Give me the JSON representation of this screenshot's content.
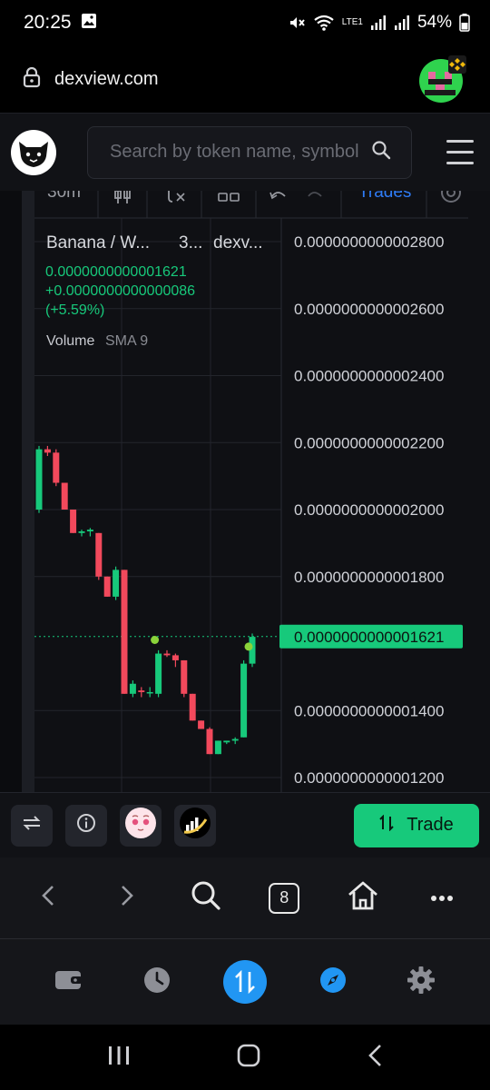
{
  "status_bar": {
    "time": "20:25",
    "network_label": "LTE1",
    "battery": "54%"
  },
  "url_bar": {
    "domain": "dexview.com"
  },
  "header": {
    "search_placeholder": "Search by token name, symbol"
  },
  "chart_toolbar": {
    "timeframe": "30m",
    "trades_label": "Trades"
  },
  "legend": {
    "pair_title": "Banana / W...",
    "interval": "3...",
    "source": "dexv...",
    "last_price": "0.0000000000001621",
    "change_abs": "+0.0000000000000086",
    "change_pct": "(+5.59%)",
    "volume_label": "Volume",
    "volume_indicator": "SMA 9"
  },
  "chart_data": {
    "type": "candlestick",
    "y_axis_ticks": [
      "0.0000000000002800",
      "0.0000000000002600",
      "0.0000000000002400",
      "0.0000000000002200",
      "0.0000000000002000",
      "0.0000000000001800",
      "0.0000000000001400",
      "0.0000000000001200"
    ],
    "ylim": [
      1.2e-13,
      2.8e-13
    ],
    "current_price_label": "0.0000000000001621",
    "current_price": 1.621e-13,
    "candles": [
      {
        "o": 2e-13,
        "h": 2.19e-13,
        "l": 1.99e-13,
        "c": 2.18e-13
      },
      {
        "o": 2.18e-13,
        "h": 2.19e-13,
        "l": 2.16e-13,
        "c": 2.17e-13
      },
      {
        "o": 2.17e-13,
        "h": 2.18e-13,
        "l": 2.07e-13,
        "c": 2.08e-13
      },
      {
        "o": 2.08e-13,
        "h": 2.08e-13,
        "l": 2e-13,
        "c": 2e-13
      },
      {
        "o": 2e-13,
        "h": 2e-13,
        "l": 1.93e-13,
        "c": 1.93e-13
      },
      {
        "o": 1.93e-13,
        "h": 1.94e-13,
        "l": 1.92e-13,
        "c": 1.935e-13
      },
      {
        "o": 1.935e-13,
        "h": 1.945e-13,
        "l": 1.92e-13,
        "c": 1.94e-13
      },
      {
        "o": 1.93e-13,
        "h": 1.93e-13,
        "l": 1.79e-13,
        "c": 1.8e-13
      },
      {
        "o": 1.8e-13,
        "h": 1.8e-13,
        "l": 1.74e-13,
        "c": 1.74e-13
      },
      {
        "o": 1.74e-13,
        "h": 1.83e-13,
        "l": 1.73e-13,
        "c": 1.82e-13
      },
      {
        "o": 1.82e-13,
        "h": 1.82e-13,
        "l": 1.45e-13,
        "c": 1.45e-13
      },
      {
        "o": 1.45e-13,
        "h": 1.49e-13,
        "l": 1.44e-13,
        "c": 1.48e-13
      },
      {
        "o": 1.46e-13,
        "h": 1.47e-13,
        "l": 1.44e-13,
        "c": 1.455e-13
      },
      {
        "o": 1.455e-13,
        "h": 1.47e-13,
        "l": 1.44e-13,
        "c": 1.455e-13
      },
      {
        "o": 1.45e-13,
        "h": 1.58e-13,
        "l": 1.44e-13,
        "c": 1.57e-13
      },
      {
        "o": 1.57e-13,
        "h": 1.58e-13,
        "l": 1.56e-13,
        "c": 1.565e-13
      },
      {
        "o": 1.565e-13,
        "h": 1.57e-13,
        "l": 1.53e-13,
        "c": 1.55e-13
      },
      {
        "o": 1.55e-13,
        "h": 1.55e-13,
        "l": 1.44e-13,
        "c": 1.45e-13
      },
      {
        "o": 1.45e-13,
        "h": 1.45e-13,
        "l": 1.37e-13,
        "c": 1.37e-13
      },
      {
        "o": 1.37e-13,
        "h": 1.37e-13,
        "l": 1.345e-13,
        "c": 1.345e-13
      },
      {
        "o": 1.345e-13,
        "h": 1.35e-13,
        "l": 1.27e-13,
        "c": 1.27e-13
      },
      {
        "o": 1.27e-13,
        "h": 1.31e-13,
        "l": 1.27e-13,
        "c": 1.31e-13
      },
      {
        "o": 1.305e-13,
        "h": 1.31e-13,
        "l": 1.3e-13,
        "c": 1.31e-13
      },
      {
        "o": 1.31e-13,
        "h": 1.32e-13,
        "l": 1.3e-13,
        "c": 1.315e-13
      },
      {
        "o": 1.32e-13,
        "h": 1.55e-13,
        "l": 1.32e-13,
        "c": 1.54e-13
      },
      {
        "o": 1.54e-13,
        "h": 1.63e-13,
        "l": 1.53e-13,
        "c": 1.62e-13
      }
    ],
    "markers": [
      {
        "index": 14,
        "price": 1.6e-13
      },
      {
        "index": 25,
        "price": 1.58e-13
      }
    ],
    "colors": {
      "up": "#17c97b",
      "down": "#f2495c",
      "grid": "#23252c",
      "axis_text": "#d0d2d8"
    }
  },
  "action_bar": {
    "trade_label": "Trade"
  },
  "browser_nav": {
    "tab_count": "8"
  },
  "colors": {
    "accent_green": "#17c97b",
    "accent_blue": "#2196f3",
    "background": "#0f1014"
  }
}
